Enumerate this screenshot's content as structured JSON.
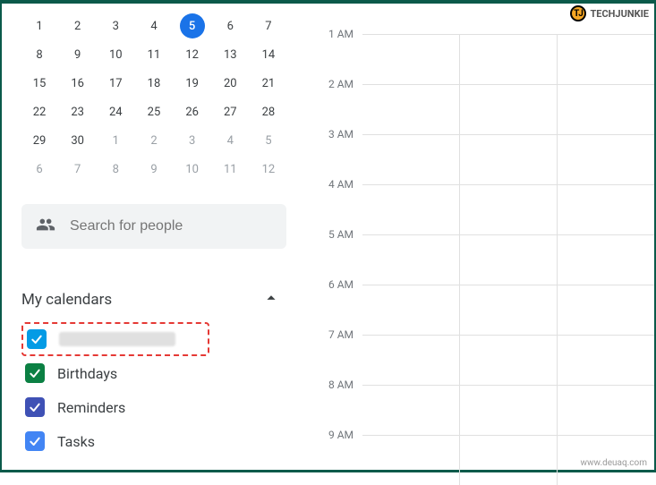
{
  "watermark_top": "TECHJUNKIE",
  "watermark_bottom": "www.deuaq.com",
  "mini_calendar": {
    "selected_day": 5,
    "rows": [
      [
        {
          "d": "1"
        },
        {
          "d": "2"
        },
        {
          "d": "3"
        },
        {
          "d": "4"
        },
        {
          "d": "5",
          "sel": true
        },
        {
          "d": "6"
        },
        {
          "d": "7"
        }
      ],
      [
        {
          "d": "8"
        },
        {
          "d": "9"
        },
        {
          "d": "10"
        },
        {
          "d": "11"
        },
        {
          "d": "12"
        },
        {
          "d": "13"
        },
        {
          "d": "14"
        }
      ],
      [
        {
          "d": "15"
        },
        {
          "d": "16"
        },
        {
          "d": "17"
        },
        {
          "d": "18"
        },
        {
          "d": "19"
        },
        {
          "d": "20"
        },
        {
          "d": "21"
        }
      ],
      [
        {
          "d": "22"
        },
        {
          "d": "23"
        },
        {
          "d": "24"
        },
        {
          "d": "25"
        },
        {
          "d": "26"
        },
        {
          "d": "27"
        },
        {
          "d": "28"
        }
      ],
      [
        {
          "d": "29"
        },
        {
          "d": "30"
        },
        {
          "d": "1",
          "m": true
        },
        {
          "d": "2",
          "m": true
        },
        {
          "d": "3",
          "m": true
        },
        {
          "d": "4",
          "m": true
        },
        {
          "d": "5",
          "m": true
        }
      ],
      [
        {
          "d": "6",
          "m": true
        },
        {
          "d": "7",
          "m": true
        },
        {
          "d": "8",
          "m": true
        },
        {
          "d": "9",
          "m": true
        },
        {
          "d": "10",
          "m": true
        },
        {
          "d": "11",
          "m": true
        },
        {
          "d": "12",
          "m": true
        }
      ]
    ]
  },
  "search": {
    "placeholder": "Search for people",
    "icon": "people-icon"
  },
  "my_calendars_header": "My calendars",
  "calendars": [
    {
      "label_hidden": true,
      "color": "#039be5",
      "checked": true,
      "highlighted": true
    },
    {
      "label": "Birthdays",
      "color": "#0b8043",
      "checked": true
    },
    {
      "label": "Reminders",
      "color": "#3f51b5",
      "checked": true
    },
    {
      "label": "Tasks",
      "color": "#4285f4",
      "checked": true
    }
  ],
  "hours": [
    "1 AM",
    "2 AM",
    "3 AM",
    "4 AM",
    "5 AM",
    "6 AM",
    "7 AM",
    "8 AM",
    "9 AM"
  ]
}
